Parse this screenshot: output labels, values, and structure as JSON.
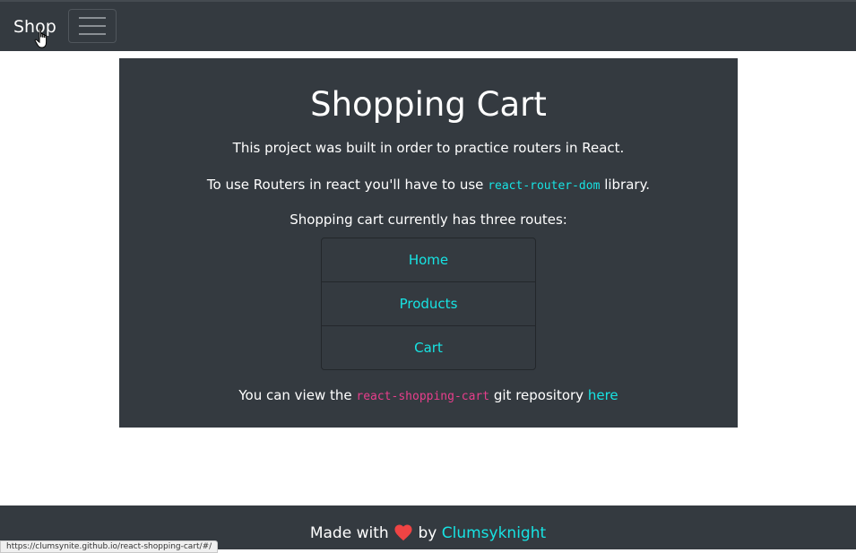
{
  "navbar": {
    "brand": "Shop",
    "toggler_icon": "hamburger-menu-icon"
  },
  "card": {
    "title": "Shopping Cart",
    "intro": "This project was built in order to practice routers in React.",
    "routers_prefix": "To use Routers in react you'll have to use ",
    "routers_code": "react-router-dom",
    "routers_suffix": " library.",
    "routes_intro": "Shopping cart currently has three routes:",
    "routes": [
      "Home",
      "Products",
      "Cart"
    ],
    "repo_prefix": "You can view the ",
    "repo_code": "react-shopping-cart",
    "repo_middle": " git repository ",
    "repo_link": "here"
  },
  "footer": {
    "prefix": "Made with ",
    "heart_icon": "heart-icon",
    "middle": " by ",
    "author": "Clumsyknight"
  },
  "status_bar": {
    "url": "https://clumsynite.github.io/react-shopping-cart/#/"
  },
  "colors": {
    "dark": "#343a40",
    "accent": "#17e3e3",
    "code_pink": "#e83e8c",
    "heart": "#ef4444"
  }
}
